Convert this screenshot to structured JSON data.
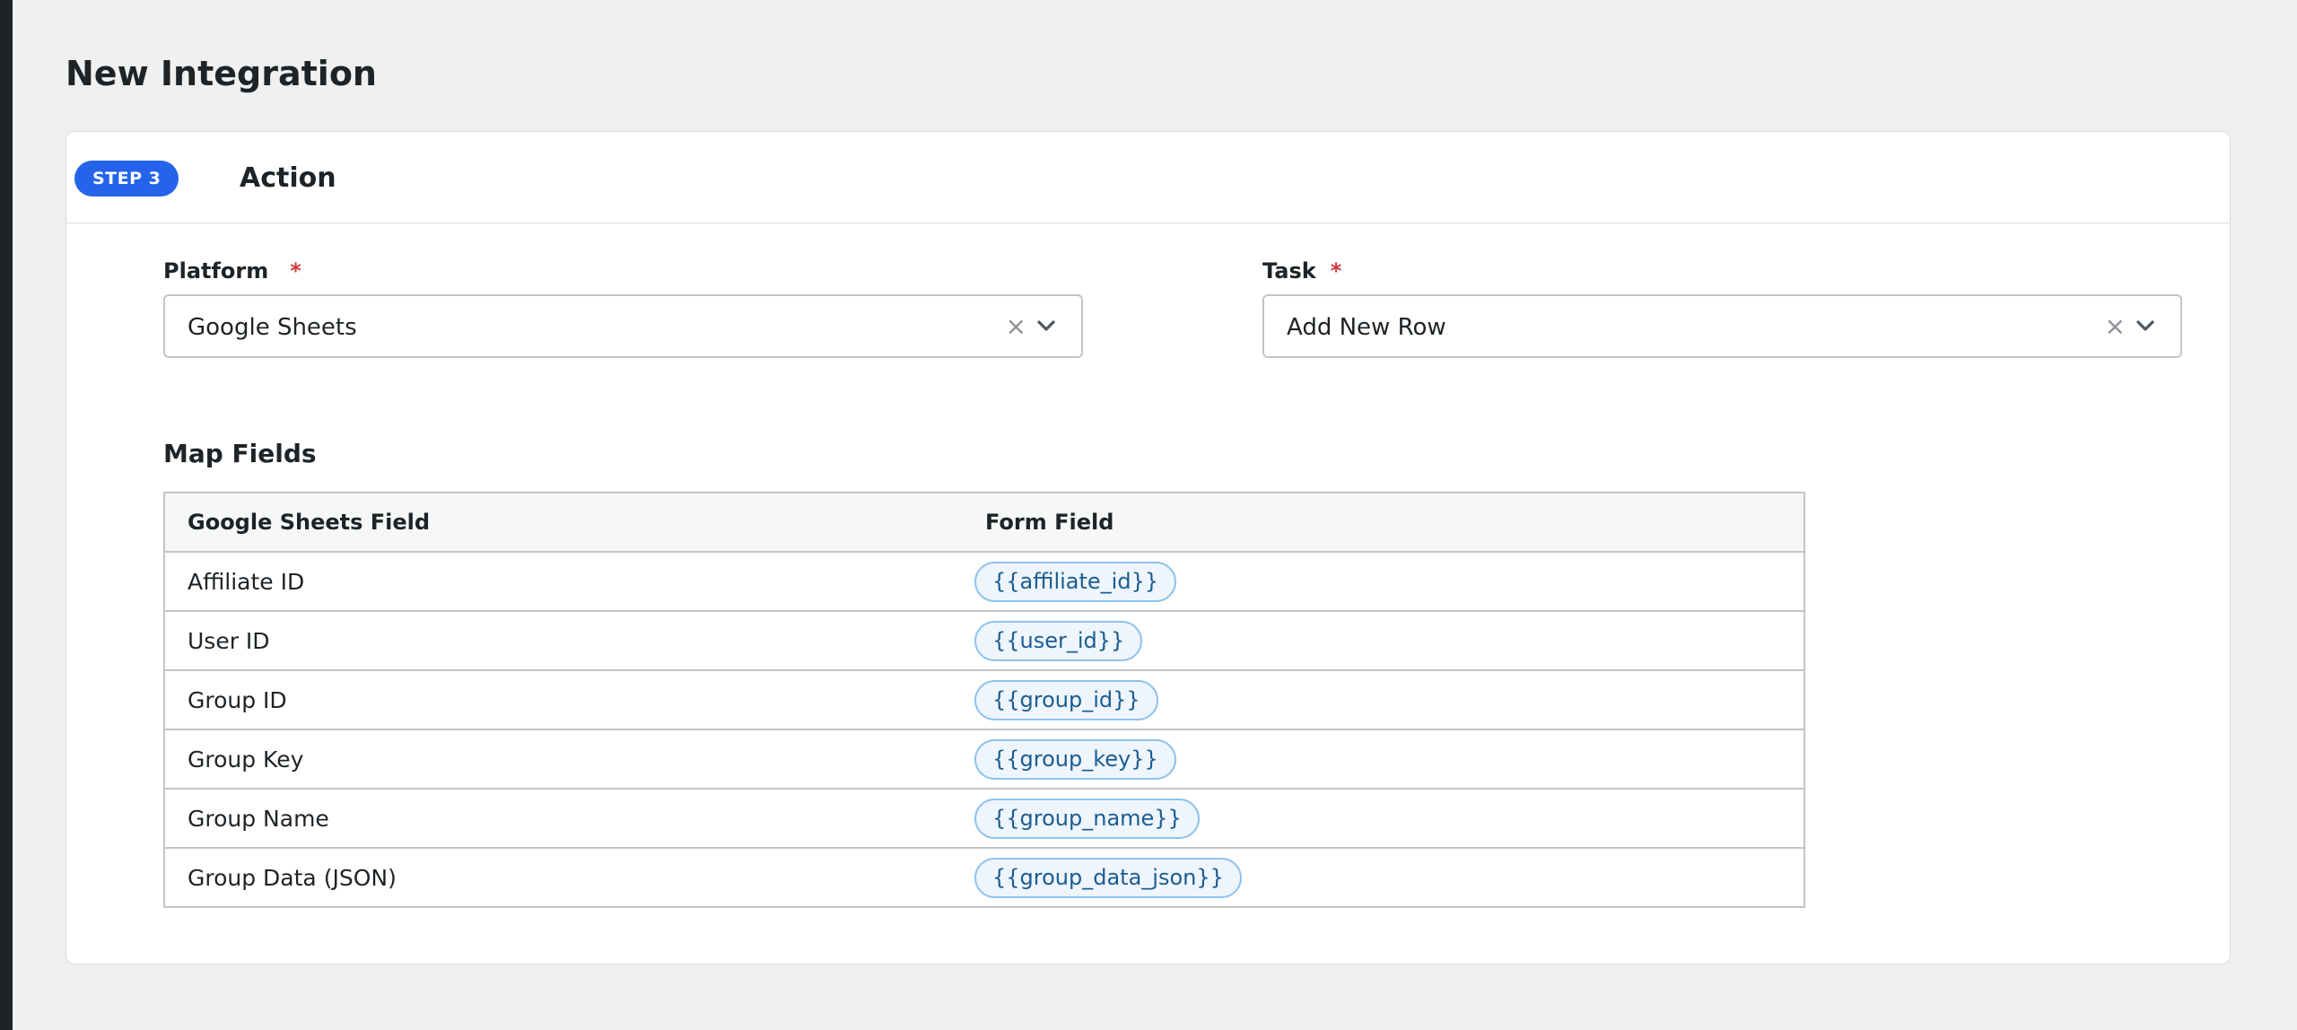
{
  "page": {
    "title": "New Integration"
  },
  "step": {
    "badge": "STEP 3",
    "title": "Action"
  },
  "platform": {
    "label": "Platform",
    "required_mark": "*",
    "value": "Google Sheets",
    "clear_glyph": "×"
  },
  "task": {
    "label": "Task",
    "required_mark": "*",
    "value": "Add New Row",
    "clear_glyph": "×"
  },
  "map_fields": {
    "title": "Map Fields",
    "columns": [
      "Google Sheets Field",
      "Form Field"
    ],
    "rows": [
      {
        "field": "Affiliate ID",
        "token": "{{affiliate_id}}"
      },
      {
        "field": "User ID",
        "token": "{{user_id}}"
      },
      {
        "field": "Group ID",
        "token": "{{group_id}}"
      },
      {
        "field": "Group Key",
        "token": "{{group_key}}"
      },
      {
        "field": "Group Name",
        "token": "{{group_name}}"
      },
      {
        "field": "Group Data (JSON)",
        "token": "{{group_data_json}}"
      }
    ]
  },
  "colors": {
    "accent": "#2563eb",
    "required": "#d63638",
    "pill_bg": "#eef5fc",
    "pill_border": "#8fc3ec",
    "pill_text": "#1b5c91"
  },
  "icons": {
    "clear": "close-icon",
    "dropdown": "chevron-down-icon"
  }
}
